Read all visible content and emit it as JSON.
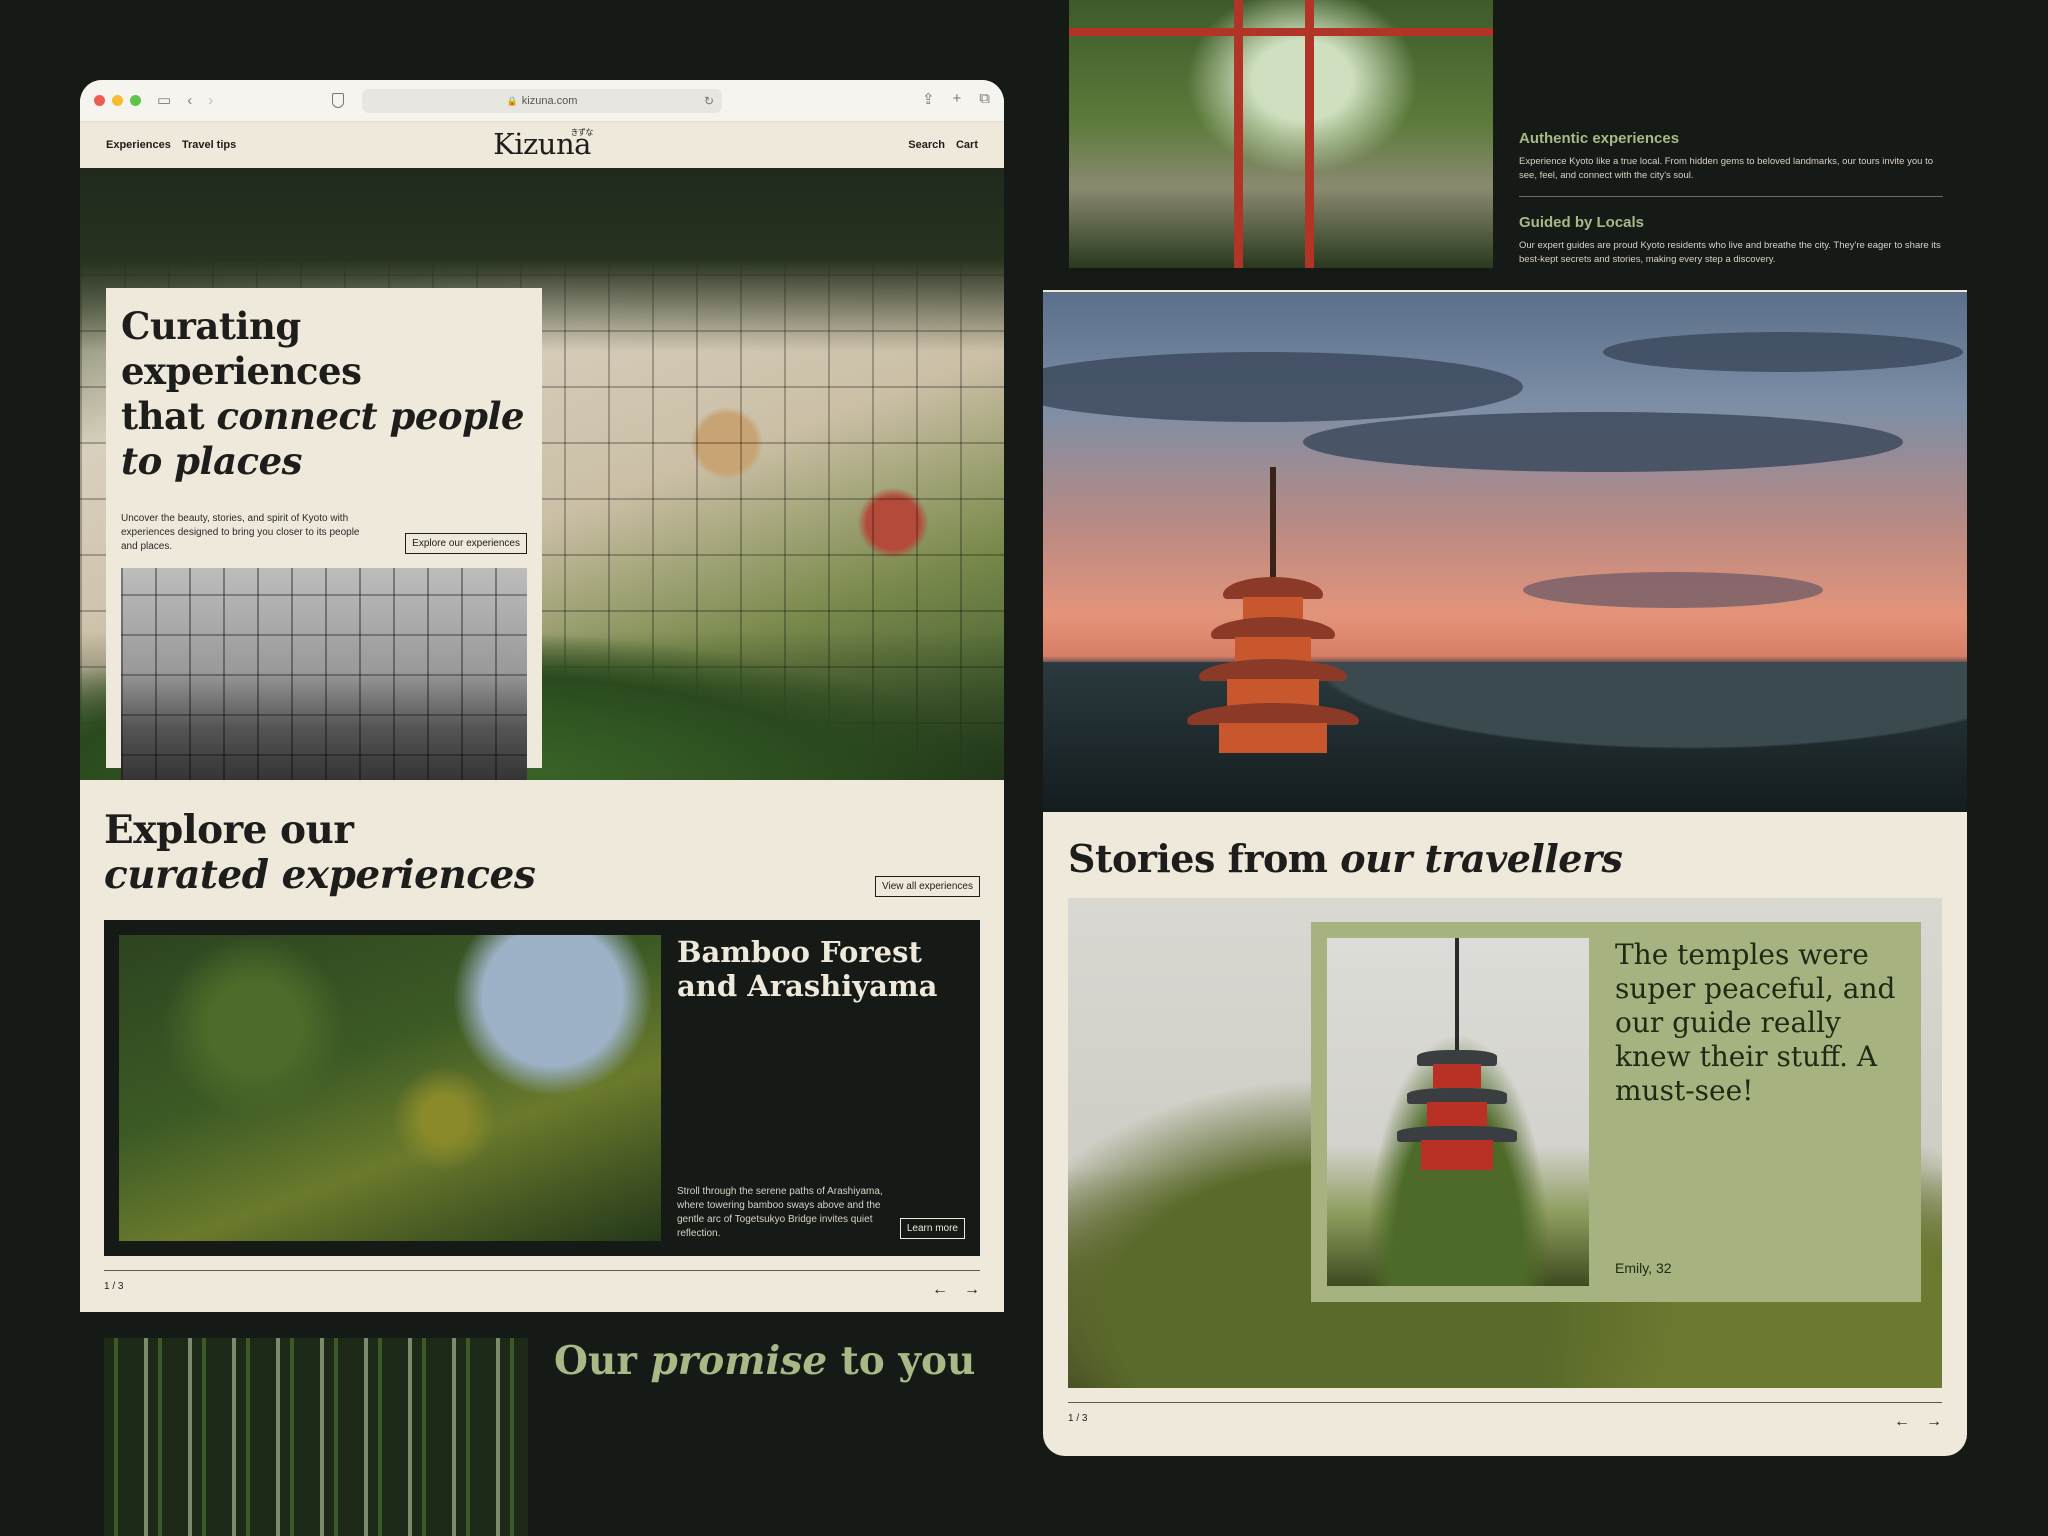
{
  "browser": {
    "url": "kizuna.com"
  },
  "site": {
    "logo": "Kizuna",
    "logo_kana": "きずな",
    "nav_left": [
      "Experiences",
      "Travel tips"
    ],
    "nav_right": [
      "Search",
      "Cart"
    ]
  },
  "hero": {
    "title_plain_1": "Curating experiences",
    "title_plain_2": "that ",
    "title_italic": "connect people to places",
    "description": "Uncover the beauty, stories, and spirit of Kyoto with experiences designed to bring you closer to its people and places.",
    "cta": "Explore our experiences"
  },
  "explore": {
    "title_plain": "Explore our",
    "title_italic": "curated experiences",
    "view_all": "View all experiences",
    "card": {
      "title": "Bamboo Forest and Arashiyama",
      "description": "Stroll through the serene paths of Arashiyama, where towering bamboo sways above and the gentle arc of Togetsukyo Bridge invites quiet reflection.",
      "cta": "Learn more"
    },
    "pager": "1 / 3"
  },
  "promise": {
    "title_plain_1": "Our ",
    "title_italic": "promise",
    "title_plain_2": " to you"
  },
  "features": [
    {
      "title": "Authentic experiences",
      "description": "Experience Kyoto like a true local. From hidden gems to beloved landmarks, our tours invite you to see, feel, and connect with the city's soul."
    },
    {
      "title": "Guided by Locals",
      "description": "Our expert guides are proud Kyoto residents who live and breathe the city. They're eager to share its best-kept secrets and stories, making every step a discovery."
    }
  ],
  "stories": {
    "title_plain": "Stories from ",
    "title_italic": "our travellers",
    "quote": "The temples were super peaceful, and our guide really knew their stuff. A must-see!",
    "author": "Emily, 32",
    "pager": "1 / 3"
  },
  "icons": {
    "arrow_left": "←",
    "arrow_right": "→"
  }
}
